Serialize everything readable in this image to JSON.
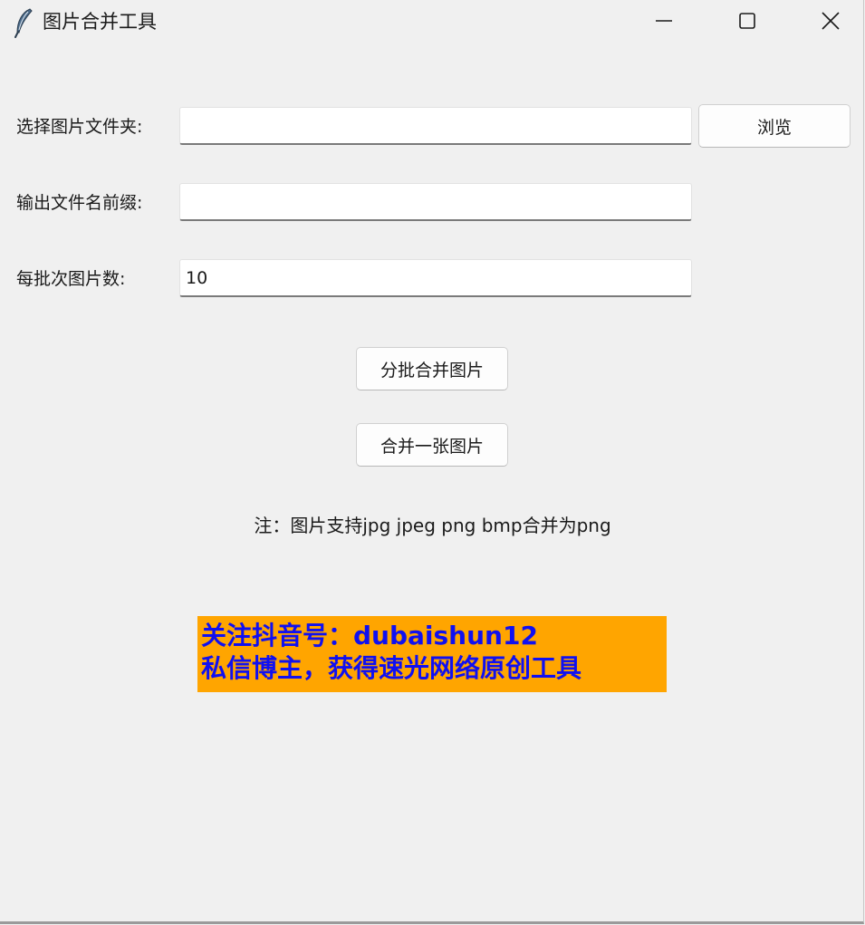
{
  "window": {
    "title": "图片合并工具",
    "app_icon": "feather-icon",
    "controls": [
      "minimize-icon",
      "maximize-icon",
      "close-icon"
    ]
  },
  "form": {
    "folder_label": "选择图片文件夹:",
    "folder_value": "",
    "browse_label": "浏览",
    "prefix_label": "输出文件名前缀:",
    "prefix_value": "",
    "batch_label": "每批次图片数:",
    "batch_value": "10"
  },
  "actions": {
    "batch_merge_label": "分批合并图片",
    "merge_one_label": "合并一张图片"
  },
  "note": "注：图片支持jpg jpeg png bmp合并为png",
  "promo": {
    "line1": "关注抖音号：dubaishun12",
    "line2": "私信博主，获得速光网络原创工具",
    "background": "#ffa500",
    "text_color": "#1010f0"
  }
}
